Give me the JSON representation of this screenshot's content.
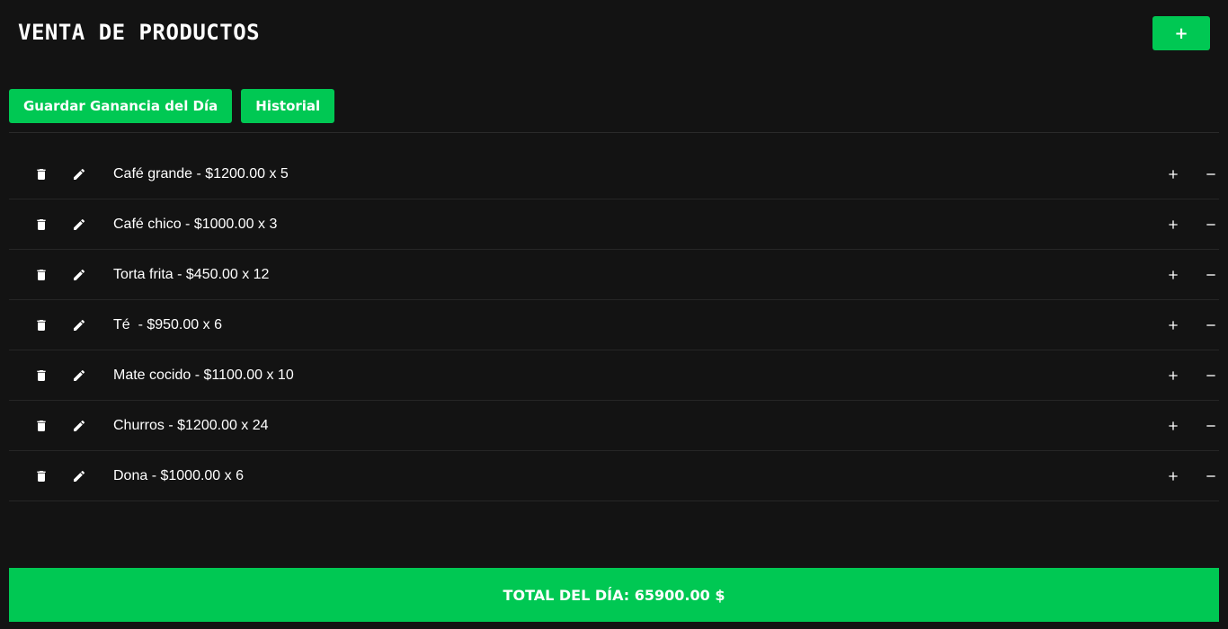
{
  "header": {
    "title": "VENTA DE PRODUCTOS",
    "add_label": "+"
  },
  "actions": {
    "save_label": "Guardar Ganancia del Día",
    "history_label": "Historial"
  },
  "products": [
    {
      "text": "Café grande - $1200.00 x 5"
    },
    {
      "text": "Café chico - $1000.00 x 3"
    },
    {
      "text": "Torta frita - $450.00 x 12"
    },
    {
      "text": "Té  - $950.00 x 6"
    },
    {
      "text": "Mate cocido - $1100.00 x 10"
    },
    {
      "text": "Churros - $1200.00 x 24"
    },
    {
      "text": "Dona - $1000.00 x 6"
    }
  ],
  "total": {
    "label": "TOTAL DEL DÍA: 65900.00 $"
  },
  "icons": {
    "delete": "trash-icon",
    "edit": "pencil-icon",
    "increment": "plus-icon",
    "decrement": "minus-icon"
  },
  "colors": {
    "accent": "#00c853",
    "background": "#131313",
    "text": "#ffffff"
  }
}
